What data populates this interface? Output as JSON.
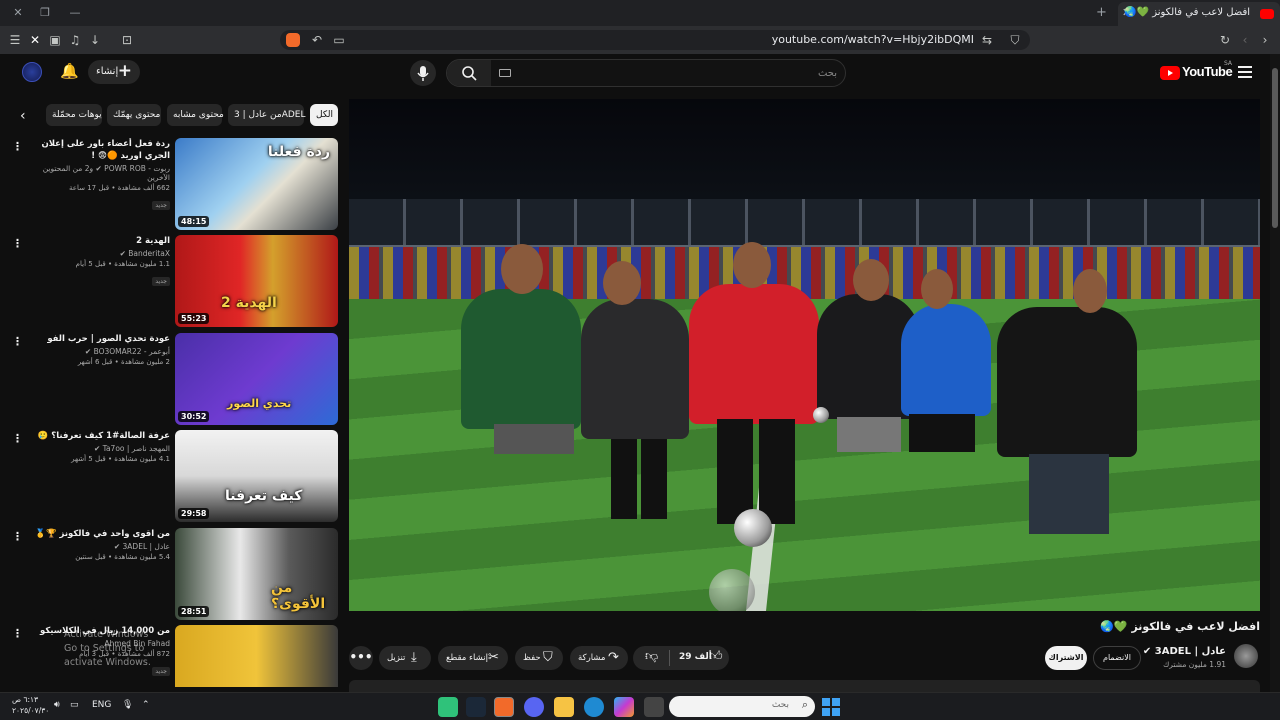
{
  "browser": {
    "tab_title": "افضل لاعب في فالكونز 💚🌏",
    "url": "youtube.com/watch?v=Hbjy2ibDQMI",
    "window_controls": [
      "—",
      "❐"
    ],
    "new_tab": "+",
    "tab_close": "✕"
  },
  "header": {
    "logo_text": "YouTube",
    "region": "SA",
    "search_placeholder": "بحث",
    "create_label": "إنشاء"
  },
  "chips": [
    {
      "label": "الكل",
      "active": true
    },
    {
      "label": "من عادل | 3ADEL",
      "active": false
    },
    {
      "label": "محتوى مشابه",
      "active": false
    },
    {
      "label": "محتوى يهمّك",
      "active": false
    },
    {
      "label": "فيديوهات محمّلة",
      "active": false
    }
  ],
  "recommendations": [
    {
      "title": "ردة فعل أعضاء باور على إعلان الجري اوريد 🟠😨 !",
      "channel": "ربوت - POWR ROB ✔ و2 من المحتوين الآخرين",
      "meta": "662 ألف مشاهدة • قبل 17 ساعة",
      "badge": "جديد",
      "duration": "48:15",
      "thumb_text": "ردة فعلنا"
    },
    {
      "title": "الهدية 2",
      "channel": "BanderitaX ✔",
      "meta": "1.1 مليون مشاهدة • قبل 5 أيام",
      "badge": "جديد",
      "duration": "55:23",
      "thumb_text": "الهدية 2"
    },
    {
      "title": "عودة تحدي الصور | حرب الفو",
      "channel": "أبوعمر - BO3OMAR22 ✔",
      "meta": "2 مليون مشاهدة • قبل 6 أشهر",
      "badge": "",
      "duration": "30:52",
      "thumb_text": "تحدي الصور"
    },
    {
      "title": "عرفة الصالة#1 كيف تعرفنا؟ 🥲",
      "channel": "المهجد ناصر | Ta7oo ✔",
      "meta": "4.1 مليون مشاهدة • قبل 5 أشهر",
      "badge": "",
      "duration": "29:58",
      "thumb_text": "كيف تعرفنا"
    },
    {
      "title": "من اقوى واحد في فالكونز 🏆🥇",
      "channel": "عادل | 3ADEL ✔",
      "meta": "5.4 مليون مشاهدة • قبل سنتين",
      "badge": "",
      "duration": "28:51",
      "thumb_text": "من الأقوى؟"
    },
    {
      "title": "من 14,000 ريال في الكلاسيكو",
      "channel": "Ahmed Bin Fahad",
      "meta": "872 ألف مشاهدة • قبل 3 أيام",
      "badge": "جديد",
      "duration": "",
      "thumb_text": ""
    }
  ],
  "video": {
    "title": "افضل لاعب في فالكونز 💚🌏",
    "channel_name": "عادل | 3ADEL ✔",
    "subscribers": "1.91 مليون مشترك",
    "join_label": "الانضمام",
    "subscribe_label": "الاشتراك",
    "likes": "29 ألف",
    "share_label": "مشاركة",
    "save_label": "حفظ",
    "clip_label": "إنشاء مقطع",
    "download_label": "تنزيل",
    "more_label": "•••"
  },
  "watermark": {
    "line1": "Activate Windows",
    "line2": "Go to Settings to activate Windows."
  },
  "taskbar": {
    "search_placeholder": "بحث",
    "language": "ENG",
    "time": "٦:١٣ ص",
    "date": "٢٠٢٥/٠٧/٣٠"
  },
  "colors": {
    "background": "#0f0f0f",
    "accent_red": "#ff0000",
    "chip_bg": "#272727"
  }
}
